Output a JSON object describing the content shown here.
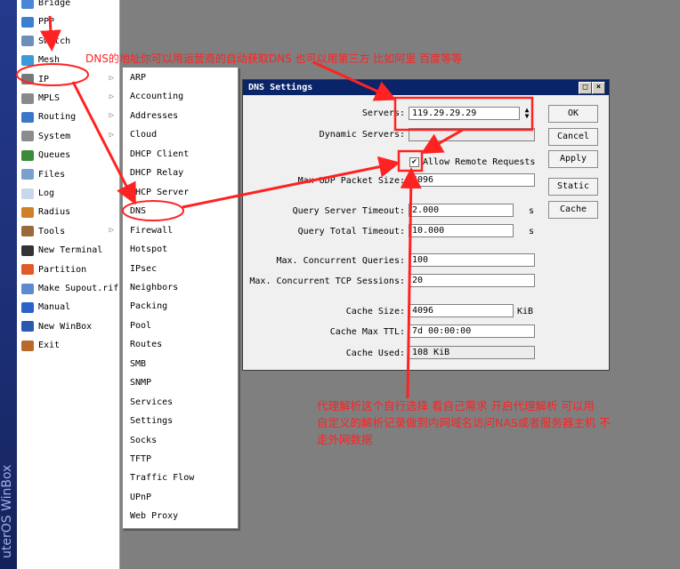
{
  "app": {
    "brand_text": "uterOS WinBox"
  },
  "main_menu": {
    "items": [
      {
        "label": "Bridge",
        "icon": "bridge-icon",
        "color": "#4a86d6"
      },
      {
        "label": "PPP",
        "icon": "ppp-icon",
        "color": "#3b7fd0"
      },
      {
        "label": "Switch",
        "icon": "switch-icon",
        "color": "#6b8fb8"
      },
      {
        "label": "Mesh",
        "icon": "mesh-icon",
        "color": "#3a9ad9"
      },
      {
        "label": "IP",
        "icon": "ip-icon",
        "color": "#777777",
        "has_submenu": true
      },
      {
        "label": "MPLS",
        "icon": "mpls-icon",
        "color": "#8a8a8a",
        "has_submenu": true
      },
      {
        "label": "Routing",
        "icon": "routing-icon",
        "color": "#3a77c9",
        "has_submenu": true
      },
      {
        "label": "System",
        "icon": "gear-icon",
        "color": "#8c8c8c",
        "has_submenu": true
      },
      {
        "label": "Queues",
        "icon": "queues-icon",
        "color": "#3c8b3a"
      },
      {
        "label": "Files",
        "icon": "folder-icon",
        "color": "#7aa0d0"
      },
      {
        "label": "Log",
        "icon": "log-icon",
        "color": "#c8d8ea"
      },
      {
        "label": "Radius",
        "icon": "users-icon",
        "color": "#d0802a"
      },
      {
        "label": "Tools",
        "icon": "tools-icon",
        "color": "#9a6a3a",
        "has_submenu": true
      },
      {
        "label": "New Terminal",
        "icon": "terminal-icon",
        "color": "#333333"
      },
      {
        "label": "Partition",
        "icon": "partition-icon",
        "color": "#e05a2a"
      },
      {
        "label": "Make Supout.rif",
        "icon": "document-icon",
        "color": "#5a8ad0"
      },
      {
        "label": "Manual",
        "icon": "help-icon",
        "color": "#2a62c9"
      },
      {
        "label": "New WinBox",
        "icon": "winbox-icon",
        "color": "#2a5ab0"
      },
      {
        "label": "Exit",
        "icon": "exit-icon",
        "color": "#b86a2a"
      }
    ]
  },
  "ip_submenu": {
    "items": [
      "ARP",
      "Accounting",
      "Addresses",
      "Cloud",
      "DHCP Client",
      "DHCP Relay",
      "DHCP Server",
      "DNS",
      "Firewall",
      "Hotspot",
      "IPsec",
      "Neighbors",
      "Packing",
      "Pool",
      "Routes",
      "SMB",
      "SNMP",
      "Services",
      "Settings",
      "Socks",
      "TFTP",
      "Traffic Flow",
      "UPnP",
      "Web Proxy"
    ]
  },
  "dns_window": {
    "title": "DNS Settings",
    "title_buttons": [
      "□",
      "×"
    ],
    "fields": {
      "servers_label": "Servers:",
      "servers_value": "119.29.29.29",
      "dynamic_servers_label": "Dynamic Servers:",
      "dynamic_servers_value": "",
      "allow_remote_label": "Allow Remote Requests",
      "allow_remote_checked": true,
      "max_udp_label": "Max UDP Packet Size:",
      "max_udp_value": "4096",
      "query_server_timeout_label": "Query Server Timeout:",
      "query_server_timeout_value": "2.000",
      "query_server_timeout_unit": "s",
      "query_total_timeout_label": "Query Total Timeout:",
      "query_total_timeout_value": "10.000",
      "query_total_timeout_unit": "s",
      "max_concurrent_queries_label": "Max. Concurrent Queries:",
      "max_concurrent_queries_value": "100",
      "max_concurrent_tcp_label": "Max. Concurrent TCP Sessions:",
      "max_concurrent_tcp_value": "20",
      "cache_size_label": "Cache Size:",
      "cache_size_value": "4096",
      "cache_size_unit": "KiB",
      "cache_max_ttl_label": "Cache Max TTL:",
      "cache_max_ttl_value": "7d 00:00:00",
      "cache_used_label": "Cache Used:",
      "cache_used_value": "108 KiB"
    },
    "buttons": {
      "ok": "OK",
      "cancel": "Cancel",
      "apply": "Apply",
      "static": "Static",
      "cache": "Cache"
    }
  },
  "annotations": {
    "top_note": "DNS的地址你可以用运营商的自动获取DNS 也可以用第三方 比如阿里 百度等等",
    "bottom_note_line1": "代理解析这个自行选择 看自己需求 开启代理解析 可以用",
    "bottom_note_line2": "自定义的解析记录做到内网域名访问NAS或者服务器主机 不",
    "bottom_note_line3": "走外网数据",
    "color": "#ff2222"
  }
}
